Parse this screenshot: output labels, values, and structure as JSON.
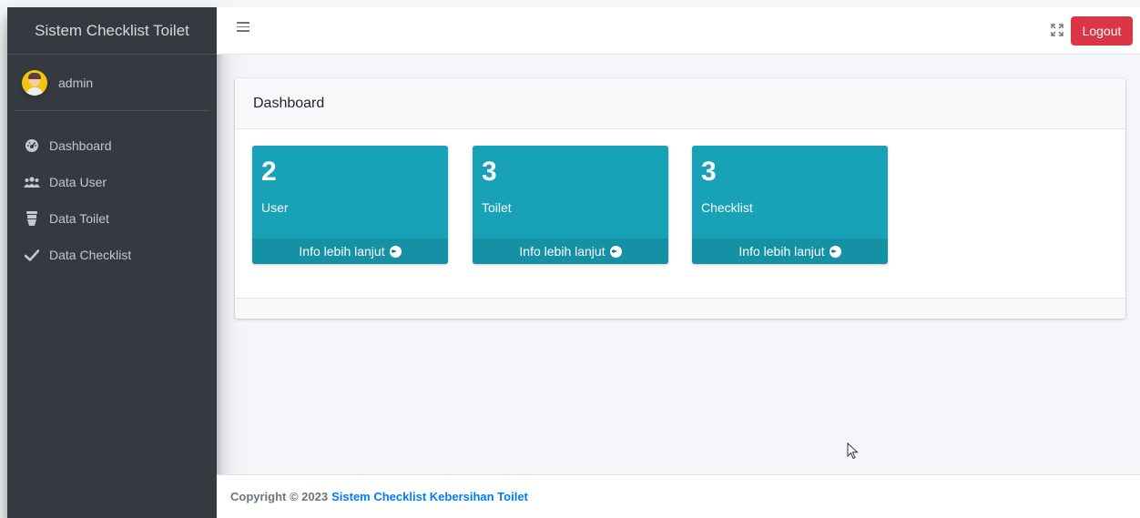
{
  "brand": {
    "title": "Sistem Checklist Toilet"
  },
  "user": {
    "name": "admin"
  },
  "sidebar": {
    "items": [
      {
        "label": "Dashboard",
        "icon": "dashboard-icon"
      },
      {
        "label": "Data User",
        "icon": "users-icon"
      },
      {
        "label": "Data Toilet",
        "icon": "toilet-icon"
      },
      {
        "label": "Data Checklist",
        "icon": "check-icon"
      }
    ]
  },
  "topbar": {
    "menu_icon": "hamburger-icon",
    "fullscreen_icon": "expand-icon",
    "logout_label": "Logout"
  },
  "main": {
    "card_title": "Dashboard",
    "boxes": [
      {
        "count": "2",
        "label": "User",
        "link": "Info lebih lanjut"
      },
      {
        "count": "3",
        "label": "Toilet",
        "link": "Info lebih lanjut"
      },
      {
        "count": "3",
        "label": "Checklist",
        "link": "Info lebih lanjut"
      }
    ]
  },
  "footer": {
    "copyright": "Copyright © 2023",
    "app_link": "Sistem Checklist Kebersihan Toilet"
  },
  "colors": {
    "sidebar_bg": "#343a40",
    "info_box": "#17a2b8",
    "logout": "#dc3545",
    "link": "#007bff"
  }
}
